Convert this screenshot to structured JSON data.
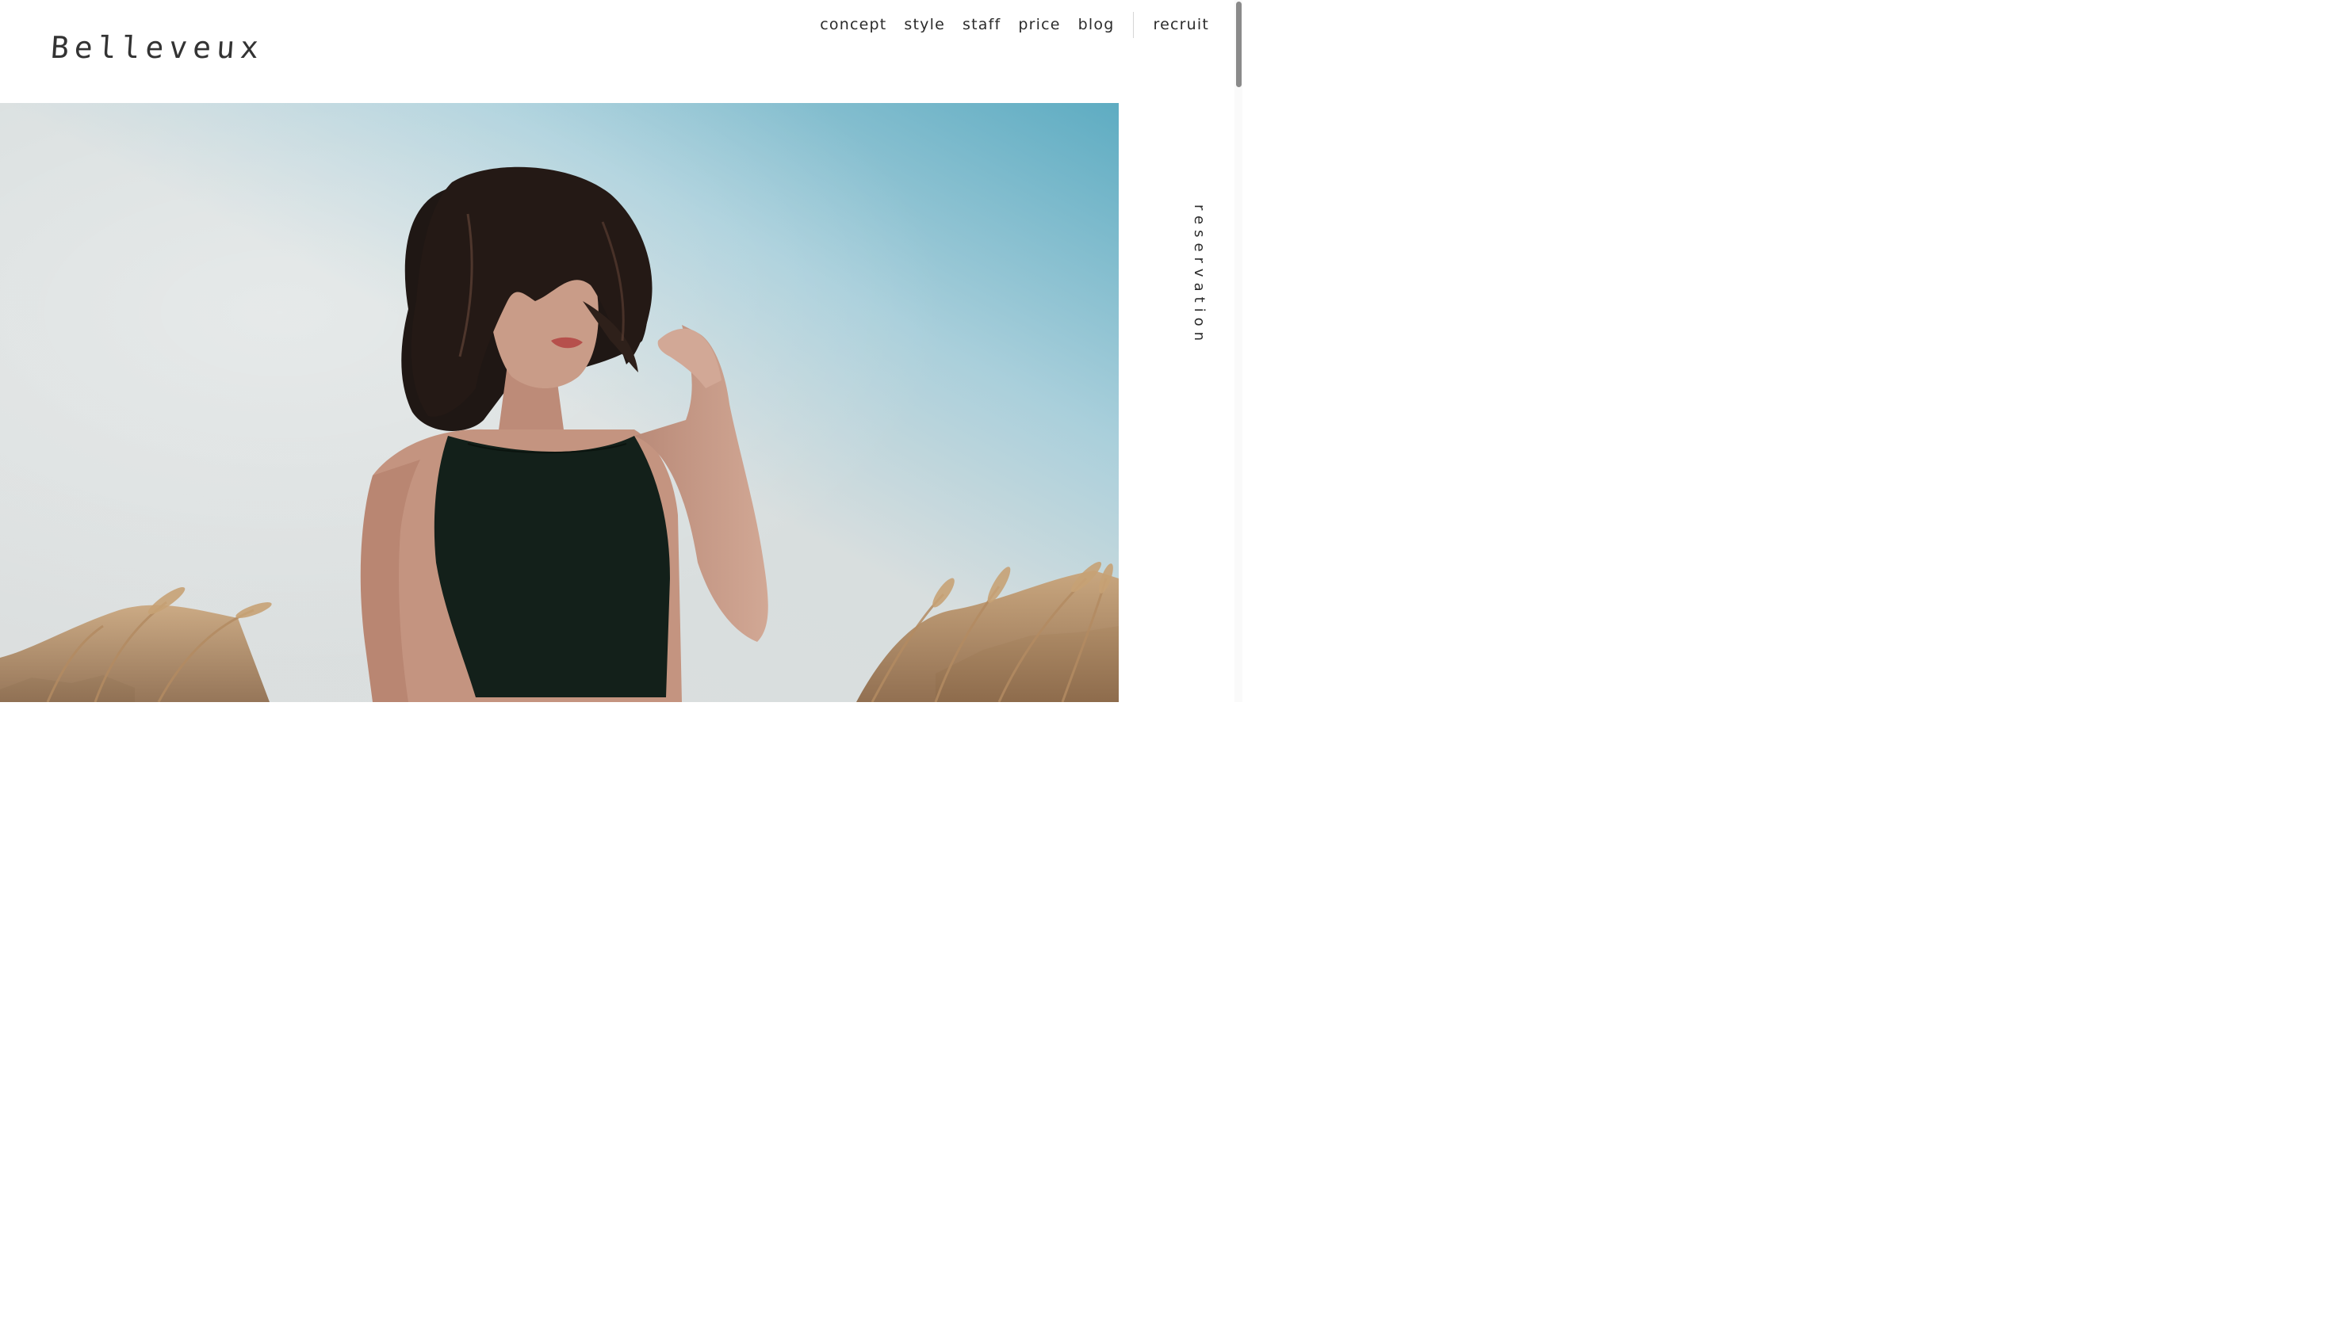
{
  "brand": {
    "logo_text": "Belleveux"
  },
  "nav": {
    "items": [
      {
        "label": "concept"
      },
      {
        "label": "style"
      },
      {
        "label": "staff"
      },
      {
        "label": "price"
      },
      {
        "label": "blog"
      }
    ],
    "recruit_label": "recruit"
  },
  "side": {
    "reservation_label": "reservation"
  },
  "colors": {
    "text": "#2a2a2a",
    "sky_light": "#dde0e0",
    "sky_blue": "#69b1c6",
    "hair": "#1f1714",
    "top_garment": "#13201a",
    "skin": "#c79a85",
    "grass": "#b78f66"
  }
}
